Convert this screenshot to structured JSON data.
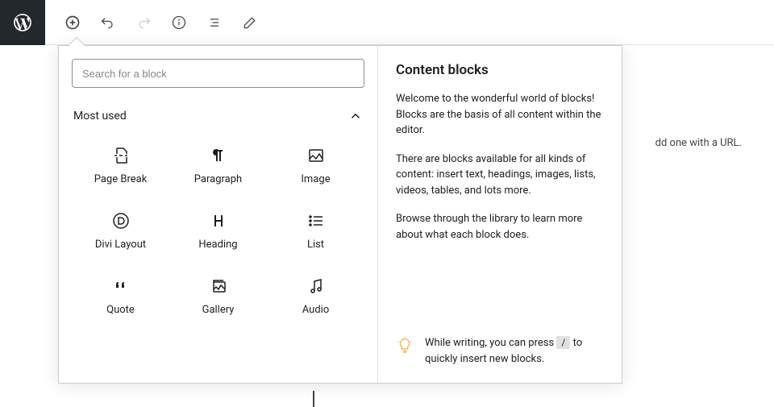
{
  "search": {
    "placeholder": "Search for a block"
  },
  "category": {
    "title": "Most used"
  },
  "blocks": [
    {
      "label": "Page Break"
    },
    {
      "label": "Paragraph"
    },
    {
      "label": "Image"
    },
    {
      "label": "Divi Layout"
    },
    {
      "label": "Heading"
    },
    {
      "label": "List"
    },
    {
      "label": "Quote"
    },
    {
      "label": "Gallery"
    },
    {
      "label": "Audio"
    }
  ],
  "info": {
    "title": "Content blocks",
    "p1": "Welcome to the wonderful world of blocks! Blocks are the basis of all content within the editor.",
    "p2": "There are blocks available for all kinds of content: insert text, headings, images, lists, videos, tables, and lots more.",
    "p3": "Browse through the library to learn more about what each block does."
  },
  "tip": {
    "before": "While writing, you can press ",
    "key": "/",
    "after": " to quickly insert new blocks."
  },
  "bg": {
    "text": "dd one with a URL."
  }
}
